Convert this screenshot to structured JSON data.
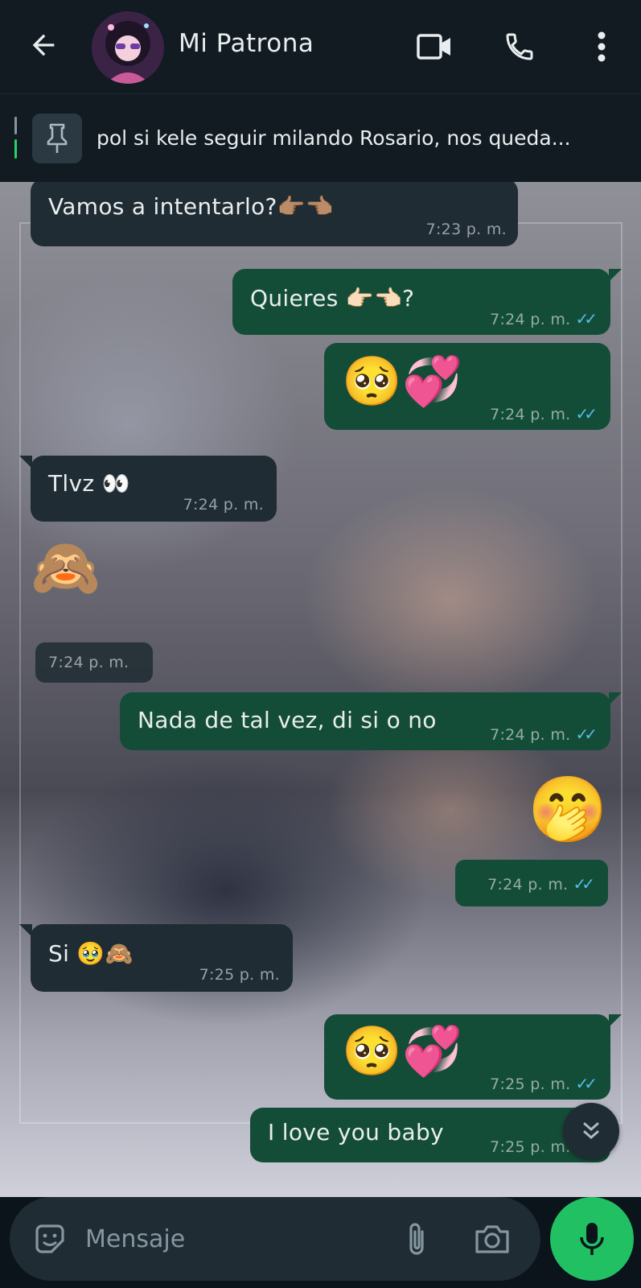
{
  "header": {
    "contact_name": "Mi Patrona",
    "icons": [
      "back-arrow-icon",
      "video-call-icon",
      "voice-call-icon",
      "more-options-icon"
    ]
  },
  "pinned": {
    "text": "pol si kele seguir milando Rosario, nos queda..."
  },
  "messages": [
    {
      "dir": "in",
      "text": "Vamos a intentarlo?👉🏽👈🏽",
      "time": "7:23 p. m."
    },
    {
      "dir": "out",
      "text": "Quieres 👉🏻👈🏻?",
      "time": "7:24 p. m.",
      "ticks": "✓✓"
    },
    {
      "dir": "out",
      "text": "🥺💞",
      "time": "7:24 p. m.",
      "ticks": "✓✓"
    },
    {
      "dir": "in",
      "text": "Tlvz 👀",
      "time": "7:24 p. m."
    },
    {
      "dir": "in",
      "text": "🙈",
      "time": "7:24 p. m."
    },
    {
      "dir": "out",
      "text": "Nada de tal vez, di si o no",
      "time": "7:24 p. m.",
      "ticks": "✓✓"
    },
    {
      "dir": "out",
      "text": "🤭",
      "time": "7:24 p. m.",
      "ticks": "✓✓"
    },
    {
      "dir": "in",
      "text": "Si 🥹🙈",
      "time": "7:25 p. m."
    },
    {
      "dir": "out",
      "text": "🥺💞",
      "time": "7:25 p. m.",
      "ticks": "✓✓"
    },
    {
      "dir": "out",
      "text": "I love you baby",
      "time": "7:25 p. m.",
      "ticks": "✓✓"
    }
  ],
  "composer": {
    "placeholder": "Mensaje",
    "icons": [
      "sticker-icon",
      "attach-icon",
      "camera-icon",
      "microphone-icon"
    ]
  },
  "colors": {
    "header_bg": "#111b21",
    "incoming_bubble": "#1f2c33",
    "outgoing_bubble": "#144d37",
    "read_ticks": "#53bdeb",
    "mic_button": "#21c063"
  }
}
